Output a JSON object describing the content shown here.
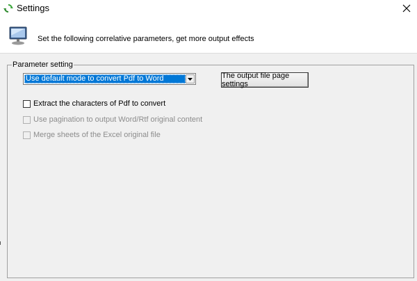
{
  "window": {
    "title": "Settings",
    "app_icon": "refresh-arrows-icon",
    "close_icon": "close-icon"
  },
  "header": {
    "icon": "monitor-icon",
    "text": "Set the following correlative parameters, get more output effects"
  },
  "parameter_group": {
    "legend": "Parameter setting",
    "mode_select": {
      "selected": "Use default mode to convert Pdf to Word",
      "arrow_icon": "chevron-down-icon"
    },
    "output_settings_button": "The output file page settings",
    "checkboxes": [
      {
        "label": "Extract the characters of Pdf to convert",
        "checked": false,
        "enabled": true
      },
      {
        "label": "Use pagination to output Word/Rtf original content",
        "checked": false,
        "enabled": false
      },
      {
        "label": "Merge sheets of the Excel original file",
        "checked": false,
        "enabled": false
      }
    ]
  },
  "colors": {
    "selection": "#0078d7",
    "dialog_bg": "#f0f0f0",
    "header_bg": "#ffffff",
    "disabled_text": "#8c8c8c",
    "icon_green": "#3aa63a"
  }
}
